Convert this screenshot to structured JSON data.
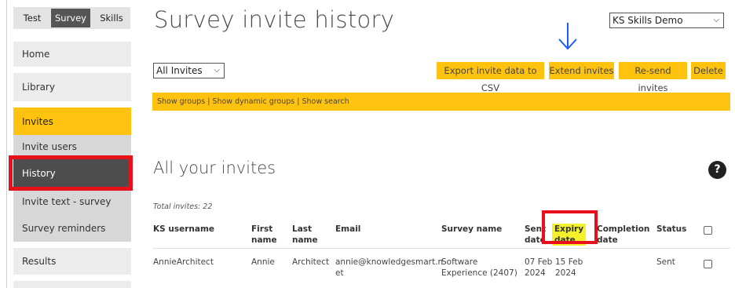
{
  "sidebar": {
    "top_tabs": [
      "Test",
      "Survey",
      "Skills"
    ],
    "nav": {
      "home": "Home",
      "library": "Library",
      "invites": "Invites",
      "invite_users": "Invite users",
      "history": "History",
      "invite_text": "Invite text - survey",
      "survey_reminders": "Survey reminders",
      "results": "Results"
    }
  },
  "header": {
    "title": "Survey invite history",
    "account_select": "KS Skills Demo"
  },
  "toolbar": {
    "filter_select": "All Invites",
    "export_label": "Export invite data to CSV",
    "extend_label": "Extend invites",
    "resend_label": "Re-send invites",
    "delete_label": "Delete"
  },
  "links_bar": "Show groups | Show dynamic groups | Show search",
  "section_title": "All your invites",
  "help_icon": "?",
  "total_invites": "Total invites: 22",
  "table": {
    "headers": {
      "username": "KS username",
      "first_line1": "First",
      "first_line2": "name",
      "last_line1": "Last",
      "last_line2": "name",
      "email": "Email",
      "survey": "Survey name",
      "sent_line1": "Sent",
      "sent_line2": "date",
      "expiry_line1": "Expiry",
      "expiry_line2": "date",
      "completion_line1": "Completion",
      "completion_line2": "date",
      "status": "Status"
    },
    "rows": [
      {
        "username": "AnnieArchitect",
        "first": "Annie",
        "last": "Architect",
        "email_line1": "annie@knowledgesmart.n",
        "email_line2": "et",
        "survey_line1": "Software",
        "survey_line2": "Experience (2407)",
        "sent_line1": "07 Feb",
        "sent_line2": "2024",
        "expiry_line1": "15 Feb",
        "expiry_line2": "2024",
        "status": "Sent"
      }
    ]
  },
  "colors": {
    "accent_yellow": "#ffc20e",
    "highlight_red": "#e8101b",
    "arrow_blue": "#1a5cff",
    "marker_yellow": "#f4f02a",
    "nav_dark": "#4d4d4d"
  },
  "icons": [
    "chevron-down-icon",
    "down-arrow-annotation-icon",
    "help-icon",
    "checkbox-icon"
  ]
}
